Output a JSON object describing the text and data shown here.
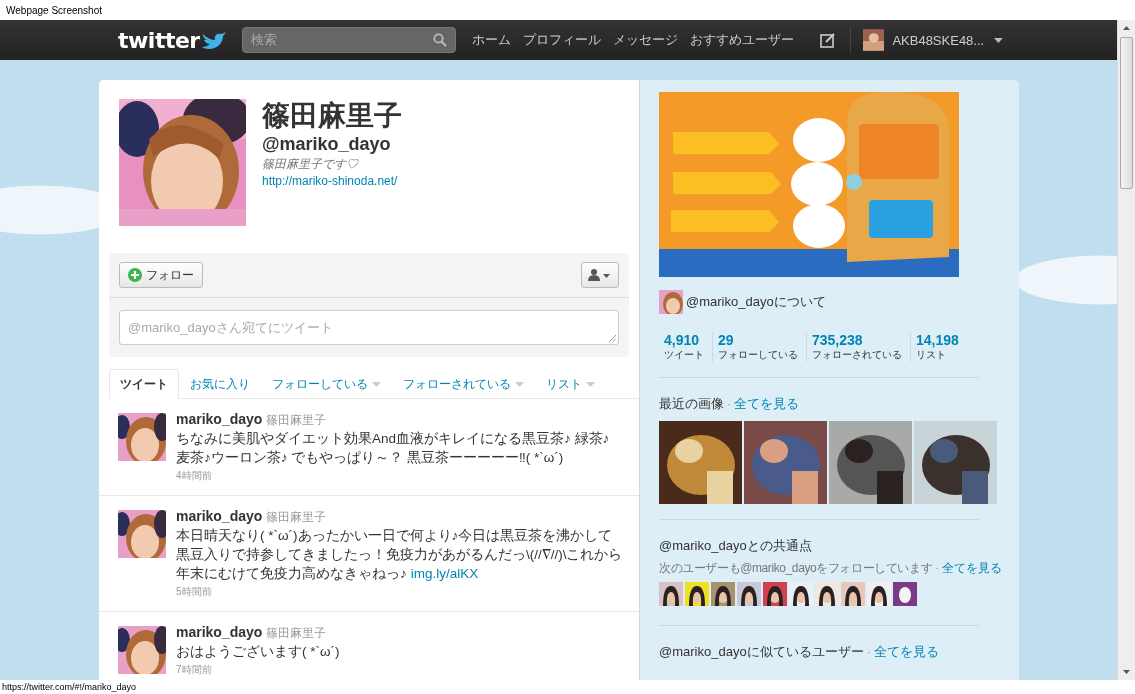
{
  "browser": {
    "title": "Webpage Screenshot",
    "status_url": "https://twitter.com/#!/mariko_dayo"
  },
  "nav": {
    "logo": "twitter",
    "search_placeholder": "検索",
    "links": [
      "ホーム",
      "プロフィール",
      "メッセージ",
      "おすすめユーザー"
    ],
    "account_name": "AKB48SKE48..."
  },
  "profile": {
    "name": "篠田麻里子",
    "handle": "@mariko_dayo",
    "bio": "篠田麻里子です♡",
    "url": "http://mariko-shinoda.net/"
  },
  "actions": {
    "follow_label": "フォロー",
    "tweet_placeholder": "@mariko_dayoさん宛てにツイート"
  },
  "tabs": [
    {
      "label": "ツイート",
      "selected": true,
      "dropdown": false
    },
    {
      "label": "お気に入り",
      "selected": false,
      "dropdown": false
    },
    {
      "label": "フォローしている",
      "selected": false,
      "dropdown": true
    },
    {
      "label": "フォローされている",
      "selected": false,
      "dropdown": true
    },
    {
      "label": "リスト",
      "selected": false,
      "dropdown": true
    }
  ],
  "tweets": [
    {
      "user": "mariko_dayo",
      "name": "篠田麻里子",
      "text": "ちなみに美肌やダイエット効果And血液がキレイになる黒豆茶♪ 緑茶♪麦茶♪ウーロン茶♪ でもやっぱり～？ 黒豆茶ーーーーー‼( *`ω´)",
      "time": "4時間前"
    },
    {
      "user": "mariko_dayo",
      "name": "篠田麻里子",
      "text": "本日晴天なり( *`ω´)あったかい一日で何より♪今日は黒豆茶を沸かして黒豆入りで持参してきましたっ！免疫力があがるんだっ\\(//∇//)\\これから年末にむけて免疫力高めなきゃねっ♪",
      "link": "img.ly/alKX",
      "time": "5時間前"
    },
    {
      "user": "mariko_dayo",
      "name": "篠田麻里子",
      "text": "おはようございます( *`ω´)",
      "time": "7時間前"
    }
  ],
  "sidebar": {
    "about": "@mariko_dayoについて",
    "stats": [
      {
        "value": "4,910",
        "label": "ツイート"
      },
      {
        "value": "29",
        "label": "フォローしている"
      },
      {
        "value": "735,238",
        "label": "フォローされている"
      },
      {
        "value": "14,198",
        "label": "リスト"
      }
    ],
    "recent_images": {
      "title": "最近の画像",
      "separator": "·",
      "see_all": "全てを見る"
    },
    "common": {
      "title": "@mariko_dayoとの共通点",
      "subtitle": "次のユーザーも@mariko_dayoをフォローしています",
      "separator": "·",
      "see_all": "全てを見る"
    },
    "similar": {
      "title": "@mariko_dayoに似ているユーザー",
      "separator": "·",
      "see_all": "全てを見る"
    }
  }
}
